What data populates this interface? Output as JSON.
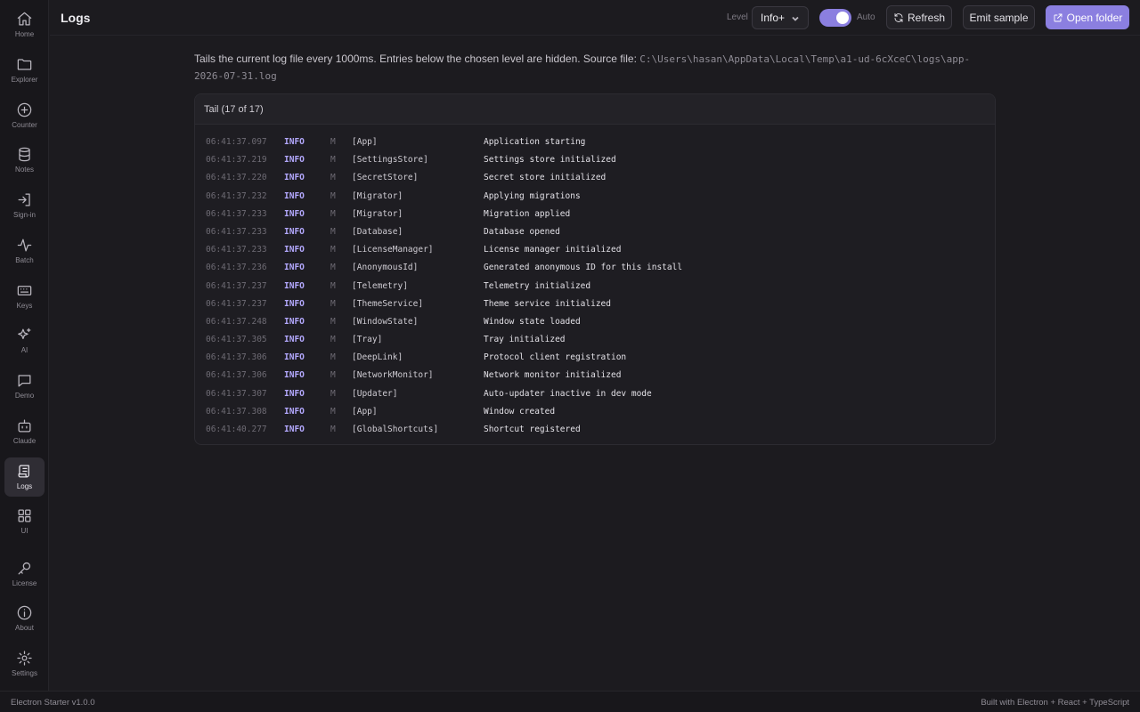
{
  "sidebar": {
    "items": [
      {
        "label": "Home",
        "icon": "home-icon"
      },
      {
        "label": "Explorer",
        "icon": "folder-icon"
      },
      {
        "label": "Counter",
        "icon": "plus-circle-icon"
      },
      {
        "label": "Notes",
        "icon": "database-icon"
      },
      {
        "label": "Sign-in",
        "icon": "sign-in-icon"
      },
      {
        "label": "Batch",
        "icon": "activity-icon"
      },
      {
        "label": "Keys",
        "icon": "keyboard-icon"
      },
      {
        "label": "AI",
        "icon": "sparkles-icon"
      },
      {
        "label": "Demo",
        "icon": "message-square-icon"
      },
      {
        "label": "Claude",
        "icon": "bot-icon"
      },
      {
        "label": "Logs",
        "icon": "scroll-icon",
        "active": true
      },
      {
        "label": "UI",
        "icon": "grid-icon"
      },
      {
        "label": "License",
        "icon": "key-icon"
      },
      {
        "label": "About",
        "icon": "info-icon"
      },
      {
        "label": "Settings",
        "icon": "gear-icon"
      }
    ]
  },
  "header": {
    "title": "Logs",
    "level_label": "Level",
    "level_value": "Info+",
    "auto_label": "Auto",
    "auto_enabled": true,
    "refresh_label": "Refresh",
    "emit_label": "Emit sample",
    "open_folder_label": "Open folder"
  },
  "description": {
    "text": "Tails the current log file every 1000ms. Entries below the chosen level are hidden. Source file: ",
    "path": "C:\\Users\\hasan\\AppData\\Local\\Temp\\a1-ud-6cXceC\\logs\\app-2026-07-31.log"
  },
  "panel": {
    "title": "Tail (17 of 17)"
  },
  "logs": [
    {
      "time": "06:41:37.097",
      "level": "INFO",
      "proc": "M",
      "scope": "[App]",
      "message": "Application starting"
    },
    {
      "time": "06:41:37.219",
      "level": "INFO",
      "proc": "M",
      "scope": "[SettingsStore]",
      "message": "Settings store initialized"
    },
    {
      "time": "06:41:37.220",
      "level": "INFO",
      "proc": "M",
      "scope": "[SecretStore]",
      "message": "Secret store initialized"
    },
    {
      "time": "06:41:37.232",
      "level": "INFO",
      "proc": "M",
      "scope": "[Migrator]",
      "message": "Applying migrations"
    },
    {
      "time": "06:41:37.233",
      "level": "INFO",
      "proc": "M",
      "scope": "[Migrator]",
      "message": "Migration applied"
    },
    {
      "time": "06:41:37.233",
      "level": "INFO",
      "proc": "M",
      "scope": "[Database]",
      "message": "Database opened"
    },
    {
      "time": "06:41:37.233",
      "level": "INFO",
      "proc": "M",
      "scope": "[LicenseManager]",
      "message": "License manager initialized"
    },
    {
      "time": "06:41:37.236",
      "level": "INFO",
      "proc": "M",
      "scope": "[AnonymousId]",
      "message": "Generated anonymous ID for this install"
    },
    {
      "time": "06:41:37.237",
      "level": "INFO",
      "proc": "M",
      "scope": "[Telemetry]",
      "message": "Telemetry initialized"
    },
    {
      "time": "06:41:37.237",
      "level": "INFO",
      "proc": "M",
      "scope": "[ThemeService]",
      "message": "Theme service initialized"
    },
    {
      "time": "06:41:37.248",
      "level": "INFO",
      "proc": "M",
      "scope": "[WindowState]",
      "message": "Window state loaded"
    },
    {
      "time": "06:41:37.305",
      "level": "INFO",
      "proc": "M",
      "scope": "[Tray]",
      "message": "Tray initialized"
    },
    {
      "time": "06:41:37.306",
      "level": "INFO",
      "proc": "M",
      "scope": "[DeepLink]",
      "message": "Protocol client registration"
    },
    {
      "time": "06:41:37.306",
      "level": "INFO",
      "proc": "M",
      "scope": "[NetworkMonitor]",
      "message": "Network monitor initialized"
    },
    {
      "time": "06:41:37.307",
      "level": "INFO",
      "proc": "M",
      "scope": "[Updater]",
      "message": "Auto-updater inactive in dev mode"
    },
    {
      "time": "06:41:37.308",
      "level": "INFO",
      "proc": "M",
      "scope": "[App]",
      "message": "Window created"
    },
    {
      "time": "06:41:40.277",
      "level": "INFO",
      "proc": "M",
      "scope": "[GlobalShortcuts]",
      "message": "Shortcut registered"
    }
  ],
  "footer": {
    "version": "Electron Starter v1.0.0",
    "built_with": "Built with Electron + React + TypeScript"
  },
  "colors": {
    "accent": "#8b7fe0",
    "level_info": "#b4a9ff",
    "background": "#1c1b1f"
  }
}
